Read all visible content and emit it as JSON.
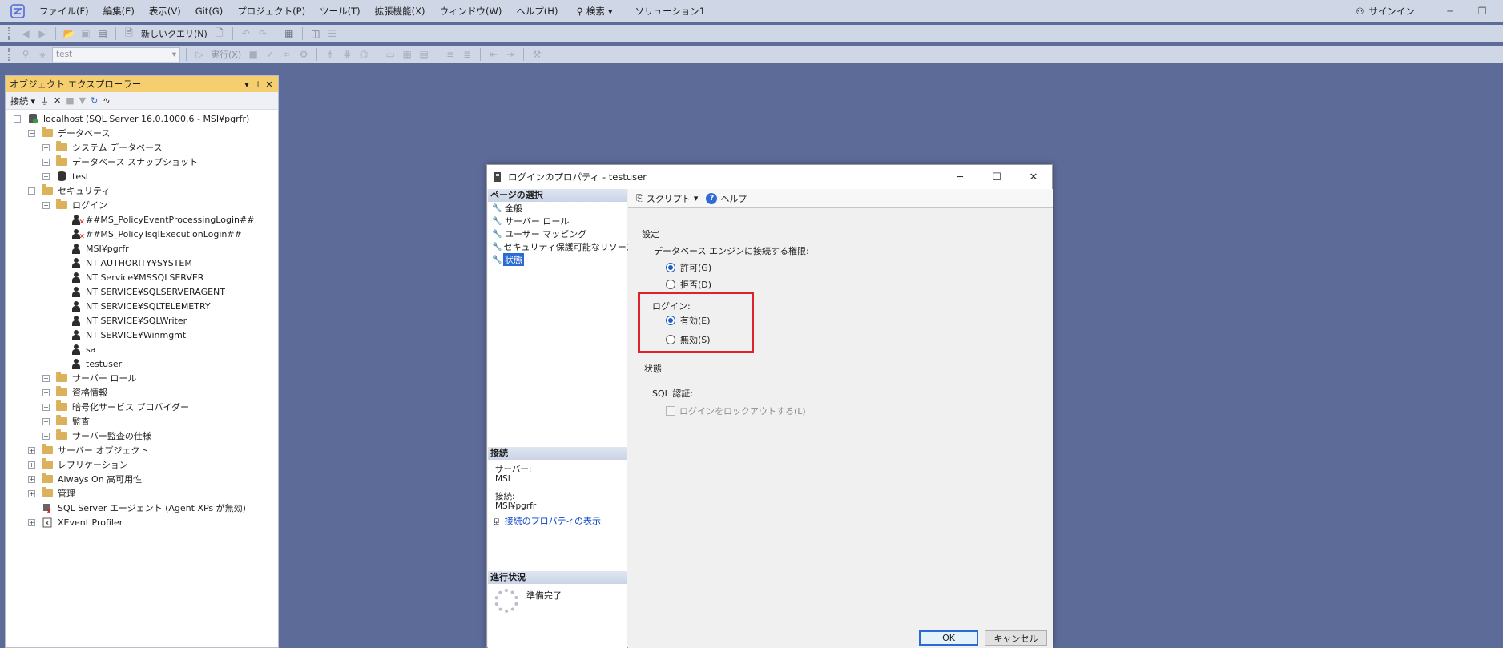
{
  "menubar": {
    "items": [
      "ファイル(F)",
      "編集(E)",
      "表示(V)",
      "Git(G)",
      "プロジェクト(P)",
      "ツール(T)",
      "拡張機能(X)",
      "ウィンドウ(W)",
      "ヘルプ(H)"
    ],
    "search_label": "検索",
    "solution": "ソリューション1",
    "signin": "サインイン"
  },
  "toolbar1": {
    "new_query": "新しいクエリ(N)"
  },
  "toolbar2": {
    "database": "test",
    "execute": "実行(X)"
  },
  "object_explorer": {
    "title": "オブジェクト エクスプローラー",
    "connect": "接続",
    "tree": [
      {
        "label": "localhost (SQL Server 16.0.1000.6 - MSI¥pgrfr)",
        "level": 0,
        "expander": "−",
        "icon": "server-icon"
      },
      {
        "label": "データベース",
        "level": 1,
        "expander": "−",
        "icon": "folder-icon"
      },
      {
        "label": "システム データベース",
        "level": 2,
        "expander": "+",
        "icon": "folder-icon"
      },
      {
        "label": "データベース スナップショット",
        "level": 2,
        "expander": "+",
        "icon": "folder-icon"
      },
      {
        "label": "test",
        "level": 2,
        "expander": "+",
        "icon": "database-icon"
      },
      {
        "label": "セキュリティ",
        "level": 1,
        "expander": "−",
        "icon": "folder-icon"
      },
      {
        "label": "ログイン",
        "level": 2,
        "expander": "−",
        "icon": "folder-icon"
      },
      {
        "label": "##MS_PolicyEventProcessingLogin##",
        "level": 3,
        "expander": "",
        "icon": "user-disabled-icon"
      },
      {
        "label": "##MS_PolicyTsqlExecutionLogin##",
        "level": 3,
        "expander": "",
        "icon": "user-disabled-icon"
      },
      {
        "label": "MSI¥pgrfr",
        "level": 3,
        "expander": "",
        "icon": "user-icon"
      },
      {
        "label": "NT AUTHORITY¥SYSTEM",
        "level": 3,
        "expander": "",
        "icon": "user-icon"
      },
      {
        "label": "NT Service¥MSSQLSERVER",
        "level": 3,
        "expander": "",
        "icon": "user-icon"
      },
      {
        "label": "NT SERVICE¥SQLSERVERAGENT",
        "level": 3,
        "expander": "",
        "icon": "user-icon"
      },
      {
        "label": "NT SERVICE¥SQLTELEMETRY",
        "level": 3,
        "expander": "",
        "icon": "user-icon"
      },
      {
        "label": "NT SERVICE¥SQLWriter",
        "level": 3,
        "expander": "",
        "icon": "user-icon"
      },
      {
        "label": "NT SERVICE¥Winmgmt",
        "level": 3,
        "expander": "",
        "icon": "user-icon"
      },
      {
        "label": "sa",
        "level": 3,
        "expander": "",
        "icon": "user-icon"
      },
      {
        "label": "testuser",
        "level": 3,
        "expander": "",
        "icon": "user-icon"
      },
      {
        "label": "サーバー ロール",
        "level": 2,
        "expander": "+",
        "icon": "folder-icon"
      },
      {
        "label": "資格情報",
        "level": 2,
        "expander": "+",
        "icon": "folder-icon"
      },
      {
        "label": "暗号化サービス プロバイダー",
        "level": 2,
        "expander": "+",
        "icon": "folder-icon"
      },
      {
        "label": "監査",
        "level": 2,
        "expander": "+",
        "icon": "folder-icon"
      },
      {
        "label": "サーバー監査の仕様",
        "level": 2,
        "expander": "+",
        "icon": "folder-icon"
      },
      {
        "label": "サーバー オブジェクト",
        "level": 1,
        "expander": "+",
        "icon": "folder-icon"
      },
      {
        "label": "レプリケーション",
        "level": 1,
        "expander": "+",
        "icon": "folder-icon"
      },
      {
        "label": "Always On 高可用性",
        "level": 1,
        "expander": "+",
        "icon": "folder-icon"
      },
      {
        "label": "管理",
        "level": 1,
        "expander": "+",
        "icon": "folder-icon"
      },
      {
        "label": "SQL Server エージェント (Agent XPs が無効)",
        "level": 1,
        "expander": "",
        "icon": "agent-icon"
      },
      {
        "label": "XEvent Profiler",
        "level": 1,
        "expander": "+",
        "icon": "xevent-icon"
      }
    ]
  },
  "dialog": {
    "title": "ログインのプロパティ - testuser",
    "page_select_header": "ページの選択",
    "pages": [
      "全般",
      "サーバー ロール",
      "ユーザー マッピング",
      "セキュリティ保護可能なリソース",
      "状態"
    ],
    "selected_page": "状態",
    "connection_header": "接続",
    "server_label": "サーバー:",
    "server_value": "MSI",
    "connection_label": "接続:",
    "connection_value": "MSI¥pgrfr",
    "view_connection_props": "接続のプロパティの表示",
    "progress_header": "進行状況",
    "progress_status": "準備完了",
    "script_label": "スクリプト",
    "help_label": "ヘルプ",
    "settings_label": "設定",
    "permission_label": "データベース エンジンに接続する権限:",
    "grant_label": "許可(G)",
    "deny_label": "拒否(D)",
    "login_label": "ログイン:",
    "enabled_label": "有効(E)",
    "disabled_label": "無効(S)",
    "status_label": "状態",
    "sql_auth_label": "SQL 認証:",
    "locked_out_label": "ログインをロックアウトする(L)",
    "ok_label": "OK",
    "cancel_label": "キャンセル"
  },
  "colors": {
    "background": "#5d6b99",
    "panel_header": "#f5cf6f",
    "highlight_box": "#e0202a",
    "link": "#0a44c6",
    "selection": "#2a6ad2"
  }
}
